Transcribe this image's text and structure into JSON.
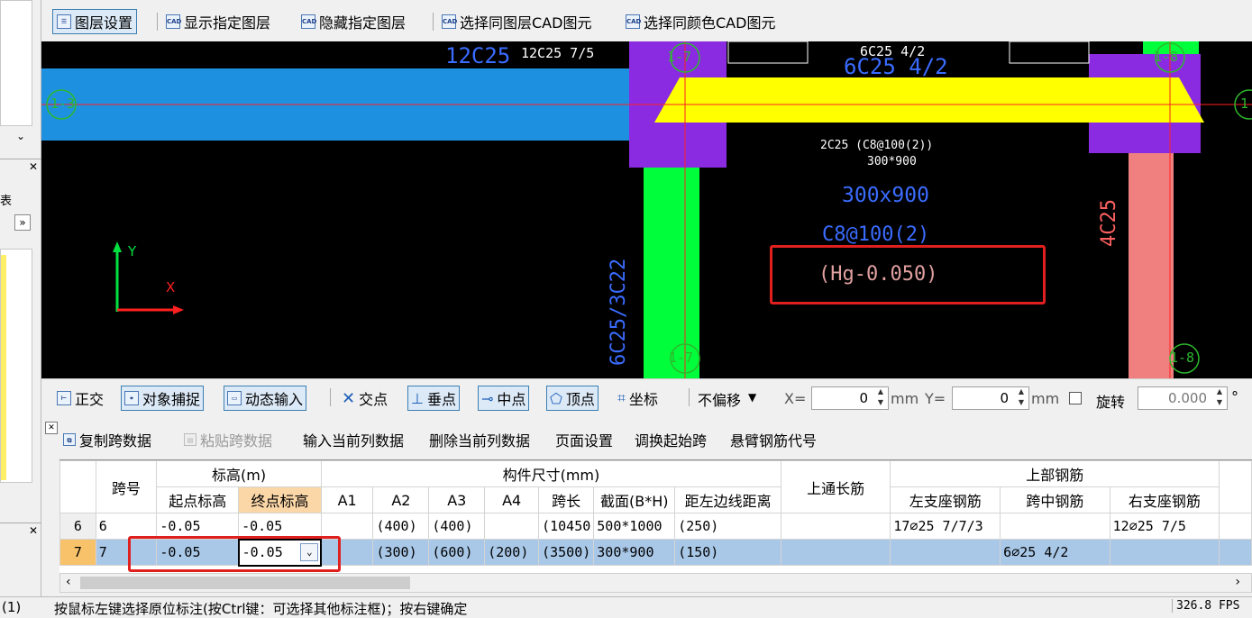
{
  "left_panel": {
    "close_1": "✕",
    "close_2": "✕",
    "expand": "»",
    "tag_1": "表",
    "chevron_down": "⌄",
    "chevron_up": "^"
  },
  "cad_toolbar": {
    "items": [
      {
        "label": "图层设置",
        "icon": "layer-settings-icon"
      },
      {
        "label": "显示指定图层",
        "icon": "cad-show-icon"
      },
      {
        "label": "隐藏指定图层",
        "icon": "cad-hide-icon"
      },
      {
        "label": "选择同图层CAD图元",
        "icon": "cad-select-layer-icon"
      },
      {
        "label": "选择同颜色CAD图元",
        "icon": "cad-select-color-icon"
      }
    ]
  },
  "cad": {
    "text_top_left_big": "12C25",
    "text_top_left_small": "12C25 7/5",
    "text_top_mid_small": "6C25 4/2",
    "text_top_mid_big": "6C25 4/2",
    "label_1_3": "1-3",
    "label_1_7_top": "1-7",
    "label_1_8_top": "1-8",
    "label_1_7_bottom": "1-7",
    "label_1_8_bottom": "1-8",
    "label_right_edge": "1",
    "stirrup_small": "2C25 (C8@100(2))",
    "section_small": "300*900",
    "section_big": "300x900",
    "stirrup_big": "C8@100(2)",
    "elevation": "(Hg-0.050)",
    "col_left_text": "6C25/3C22",
    "col_right_text": "4C25",
    "axis_y": "Y",
    "axis_x": "X"
  },
  "snap_toolbar": {
    "items": [
      "正交",
      "对象捕捉",
      "动态输入",
      "交点",
      "垂点",
      "中点",
      "顶点",
      "坐标"
    ],
    "offset_select": "不偏移",
    "x_label": "X=",
    "x_value": "0",
    "mm1": "mm",
    "y_label": "Y=",
    "y_value": "0",
    "mm2": "mm",
    "rotate_label": "旋转",
    "rotate_value": "0.000",
    "degree": "°"
  },
  "table_toolbar": {
    "items": [
      "复制跨数据",
      "粘贴跨数据",
      "输入当前列数据",
      "删除当前列数据",
      "页面设置",
      "调换起始跨",
      "悬臂钢筋代号"
    ]
  },
  "grid": {
    "header_top": {
      "span_no": "跨号",
      "elevation": "标高(m)",
      "dims": "构件尺寸(mm)",
      "top_through": "上通长筋",
      "top_rebar": "上部钢筋"
    },
    "header_sub": [
      "起点标高",
      "终点标高",
      "A1",
      "A2",
      "A3",
      "A4",
      "跨长",
      "截面(B*H)",
      "距左边线距离",
      "左支座钢筋",
      "跨中钢筋",
      "右支座钢筋"
    ],
    "rows": [
      {
        "rn": "6",
        "span": "6",
        "start": "-0.05",
        "end": "-0.05",
        "a1": "",
        "a2": "(400)",
        "a3": "(400)",
        "a4": "",
        "len": "(10450",
        "sec": "500*1000",
        "dist": "(250)",
        "through": "",
        "left": "17⌀25 7/7/3",
        "mid": "",
        "right": "12⌀25 7/5"
      },
      {
        "rn": "7",
        "span": "7",
        "start": "-0.05",
        "end": "-0.05",
        "a1": "",
        "a2": "(300)",
        "a3": "(600)",
        "a4": "(200)",
        "len": "(3500)",
        "sec": "300*900",
        "dist": "(150)",
        "through": "",
        "left": "",
        "mid": "6⌀25 4/2",
        "right": ""
      }
    ]
  },
  "status_bar": {
    "left_text": "(1)",
    "message": "按鼠标左键选择原位标注(按Ctrl键：可选择其他标注框)；按右键确定",
    "fps": "326.8 FPS"
  },
  "colors": {
    "beam_blue": "#1e90e0",
    "beam_yellow": "#ffff00",
    "column_purple": "#8a2be2",
    "column_green": "#00ff3a",
    "column_pink": "#f08080",
    "highlight_red": "#e0201f",
    "cad_text_blue": "#3a6cff"
  }
}
